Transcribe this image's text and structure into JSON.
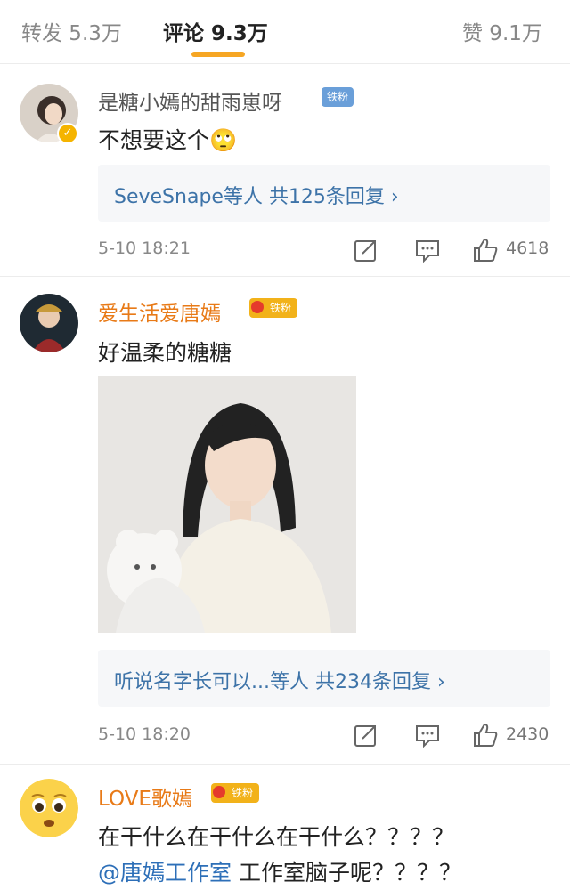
{
  "tabs": {
    "repost": "转发 5.3万",
    "comments": "评论 9.3万",
    "likes": "赞 9.1万"
  },
  "comments": [
    {
      "username": "是糖小嫣的甜雨崽呀",
      "fan_badge": "铁粉",
      "text": "不想要这个🙄",
      "replies": "SeveSnape等人 共125条回复 ›",
      "time": "5-10 18:21",
      "like_count": "4618"
    },
    {
      "username": "爱生活爱唐嫣",
      "fan_badge": "铁粉",
      "text": "好温柔的糖糖",
      "replies": "听说名字长可以...等人 共234条回复 ›",
      "time": "5-10 18:20",
      "like_count": "2430"
    },
    {
      "username": "LOVE歌嫣",
      "fan_badge": "铁粉",
      "text_line1": "在干什么在干什么在干什么？？？？",
      "mention": "@唐嫣工作室",
      "text_line2": " 工作室脑子呢？？？？"
    }
  ],
  "colors": {
    "accent": "#f6a623",
    "vip_name": "#e87a17",
    "link": "#3d73a8"
  },
  "icons": [
    "repost-icon",
    "comment-icon",
    "like-icon",
    "verified-icon",
    "crown-icon"
  ]
}
